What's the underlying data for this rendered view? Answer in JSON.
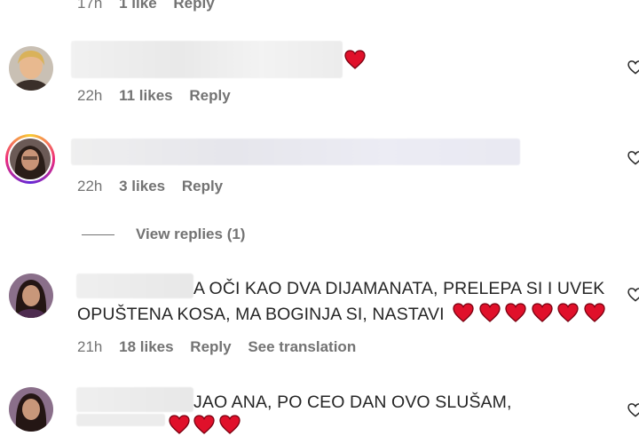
{
  "top_partial": {
    "time": "17h",
    "likes": "1 like",
    "reply": "Reply"
  },
  "comments": [
    {
      "text": "",
      "time": "22h",
      "likes": "11 likes",
      "reply": "Reply",
      "icon": "heart-emoji"
    },
    {
      "text": "",
      "time": "22h",
      "likes": "3 likes",
      "reply": "Reply"
    },
    {
      "text_line1": "A OČI KAO DVA DIJAMANATA, PRELEPA SI I UVEK",
      "text_line2": "OPUŠTENA KOSA, MA BOGINJA SI, NASTAVI",
      "time": "21h",
      "likes": "18 likes",
      "reply": "Reply",
      "translation": "See translation"
    },
    {
      "text_line1": "JAO ANA, PO CEO DAN OVO SLUŠAM,"
    }
  ],
  "view_replies": "View replies (1)",
  "colors": {
    "heart": "#e0102a",
    "meta": "#737373",
    "text": "#262626"
  }
}
